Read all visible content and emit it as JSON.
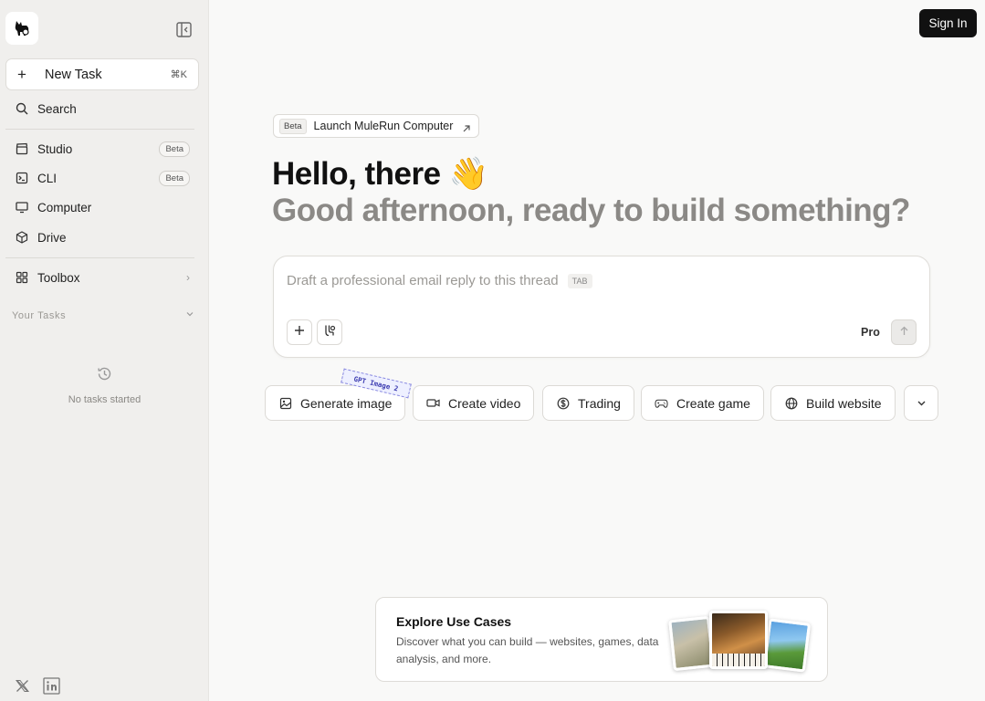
{
  "sidebar": {
    "new_task": {
      "label": "New Task",
      "shortcut": "⌘K"
    },
    "search": {
      "label": "Search"
    },
    "items": [
      {
        "label": "Studio",
        "badge": "Beta"
      },
      {
        "label": "CLI",
        "badge": "Beta"
      },
      {
        "label": "Computer"
      },
      {
        "label": "Drive"
      }
    ],
    "toolbox": {
      "label": "Toolbox"
    },
    "your_tasks_label": "Your Tasks",
    "empty_tasks": "No tasks started"
  },
  "header": {
    "sign_in": "Sign In"
  },
  "main": {
    "beta_pill": {
      "badge": "Beta",
      "label": "Launch MuleRun Computer"
    },
    "hello": "Hello, there 👋",
    "greeting": "Good afternoon, ready to build something?",
    "composer": {
      "placeholder": "Draft a professional email reply to this thread",
      "tab_hint": "TAB",
      "model": "Pro"
    },
    "chips": [
      {
        "label": "Generate image",
        "icon": "image-icon"
      },
      {
        "label": "Create video",
        "icon": "video-icon"
      },
      {
        "label": "Trading",
        "icon": "dollar-icon"
      },
      {
        "label": "Create game",
        "icon": "gamepad-icon"
      },
      {
        "label": "Build website",
        "icon": "globe-icon"
      }
    ],
    "gpt_tag": "GPT Image 2",
    "explore": {
      "title": "Explore Use Cases",
      "description": "Discover what you can build — websites, games, data analysis, and more."
    }
  },
  "colors": {
    "sidebar_bg": "#f0efed",
    "main_bg": "#f9f9f8",
    "sign_in_bg": "#111111",
    "greeting_gray": "#8b8986",
    "gpt_tag_accent": "#3b3bb0"
  }
}
